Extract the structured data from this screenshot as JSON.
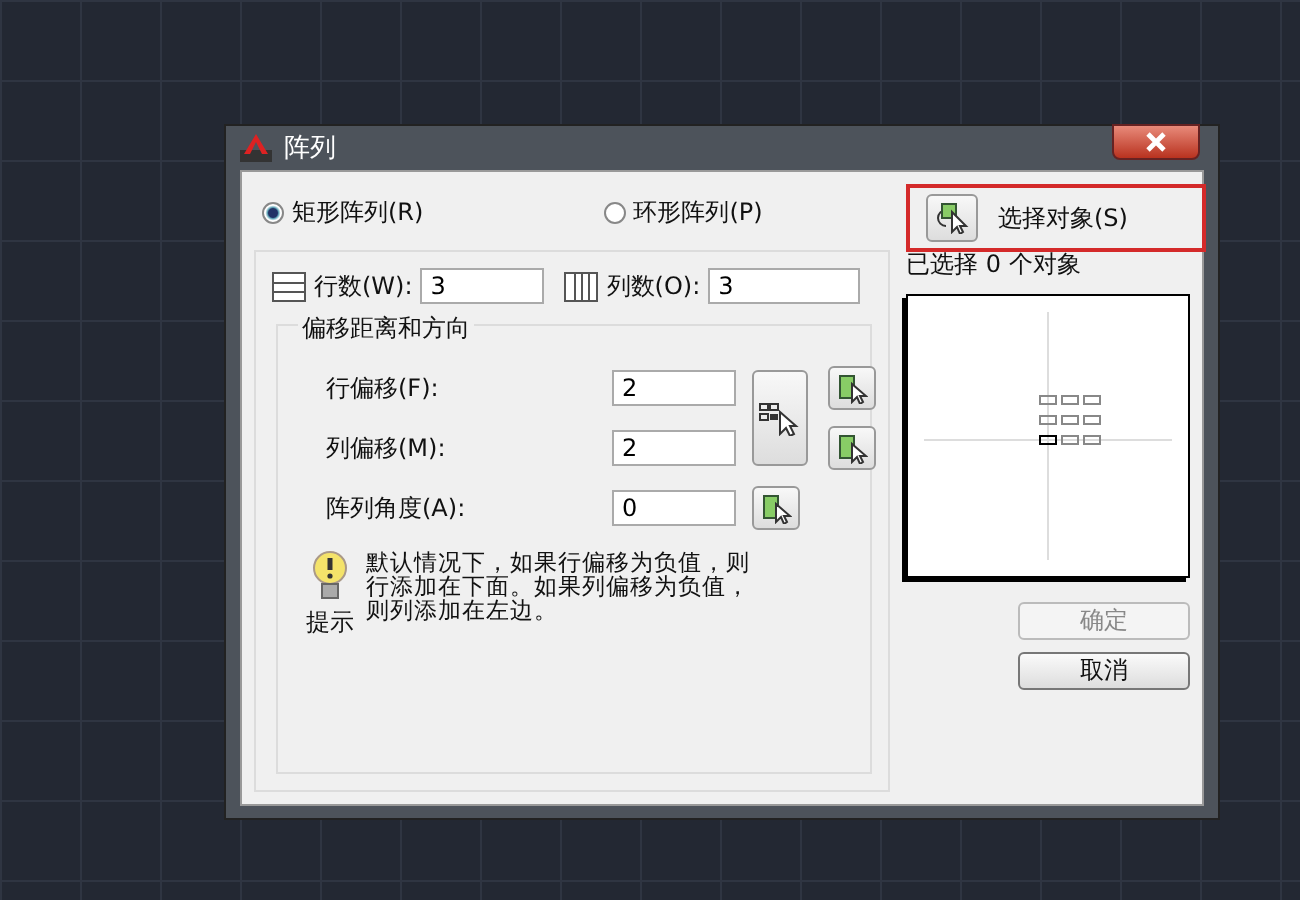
{
  "window": {
    "title": "阵列"
  },
  "array_types": [
    {
      "label": "矩形阵列(R)",
      "selected": true
    },
    {
      "label": "环形阵列(P)",
      "selected": false
    }
  ],
  "rows": {
    "label": "行数(W):",
    "value": "3"
  },
  "columns": {
    "label": "列数(O):",
    "value": "3"
  },
  "offset_group": {
    "title": "偏移距离和方向",
    "fields": [
      {
        "label": "行偏移(F):",
        "value": "2"
      },
      {
        "label": "列偏移(M):",
        "value": "2"
      },
      {
        "label": "阵列角度(A):",
        "value": "0"
      }
    ]
  },
  "hint": {
    "label": "提示",
    "text": "默认情况下，如果行偏移为负值，则行添加在下面。如果列偏移为负值，则列添加在左边。"
  },
  "select_objects": {
    "label": "选择对象(S)",
    "highlighted": true
  },
  "selection_count": "已选择 0 个对象",
  "buttons": [
    {
      "label": "确定",
      "disabled": true
    },
    {
      "label": "取消",
      "disabled": false
    }
  ]
}
